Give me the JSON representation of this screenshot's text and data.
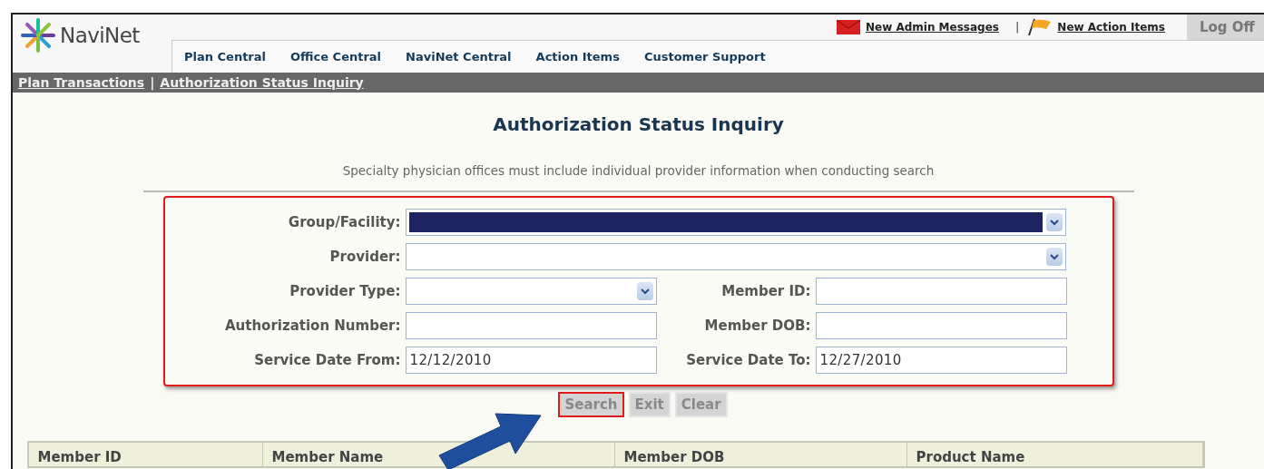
{
  "logo": {
    "text": "NaviNet"
  },
  "top_links": [
    {
      "label": "New Admin Messages",
      "kind": "mail"
    },
    {
      "label": "New Action Items",
      "kind": "flag"
    }
  ],
  "top_separator": "|",
  "logoff": {
    "label": "Log Off"
  },
  "nav": [
    {
      "label": "Plan Central"
    },
    {
      "label": "Office Central"
    },
    {
      "label": "NaviNet Central"
    },
    {
      "label": "Action Items"
    },
    {
      "label": "Customer Support"
    }
  ],
  "breadcrumb": {
    "items": [
      "Plan Transactions",
      "Authorization Status Inquiry"
    ],
    "separator": "|"
  },
  "title": "Authorization Status Inquiry",
  "note": "Specialty physician offices must include individual provider information when conducting search",
  "form": {
    "highlighted": true,
    "rows": [
      [
        {
          "label": "Group/Facility:",
          "kind": "select",
          "wide": true,
          "focused": true
        }
      ],
      [
        {
          "label": "Provider:",
          "kind": "select",
          "wide": true,
          "focused": false
        }
      ],
      [
        {
          "label": "Provider Type:",
          "kind": "select",
          "focused": false
        },
        {
          "label": "Member ID:",
          "kind": "text",
          "focused": false
        }
      ],
      [
        {
          "label": "Authorization Number:",
          "kind": "text",
          "focused": false
        },
        {
          "label": "Member DOB:",
          "kind": "text",
          "focused": false
        }
      ],
      [
        {
          "label": "Service Date From:",
          "kind": "text",
          "value": "12/12/2010",
          "focused": false
        },
        {
          "label": "Service Date To:",
          "kind": "text",
          "value": "12/27/2010",
          "focused": false
        }
      ]
    ]
  },
  "buttons": [
    {
      "label": "Search",
      "highlighted": true
    },
    {
      "label": "Exit",
      "highlighted": false
    },
    {
      "label": "Clear",
      "highlighted": false
    }
  ],
  "table": {
    "columns": [
      "Member ID",
      "Member Name",
      "Member DOB",
      "Product Name"
    ]
  }
}
